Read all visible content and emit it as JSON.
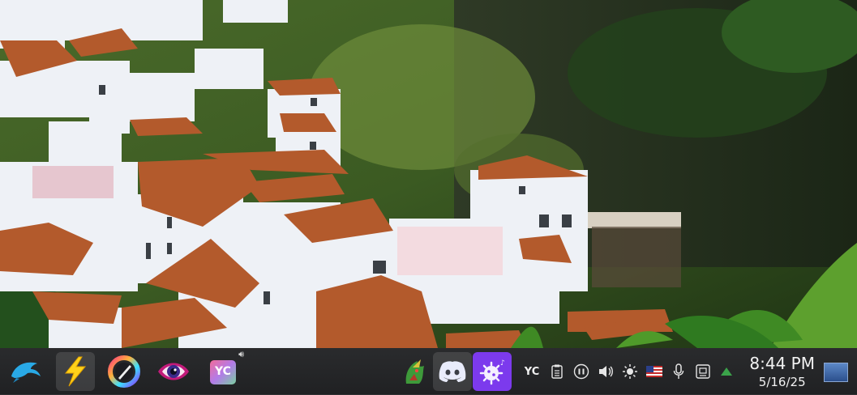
{
  "taskbar": {
    "launchers": [
      {
        "name": "Dolphin",
        "icon": "dolphin-icon"
      },
      {
        "name": "Lightning",
        "icon": "lightning-icon",
        "active": true
      },
      {
        "name": "Paint",
        "icon": "paint-brush-icon"
      },
      {
        "name": "Eye",
        "icon": "eye-icon"
      },
      {
        "name": "YC",
        "icon": "yc-app-icon",
        "label": "YC"
      }
    ],
    "tasks": [
      {
        "icon": "dragon-app-icon"
      },
      {
        "icon": "discord-icon",
        "active": true
      },
      {
        "icon": "virus-app-icon"
      }
    ],
    "tray": {
      "yc_label": "YC",
      "icons": [
        "yc-tray-icon",
        "clipboard-icon",
        "media-icon",
        "volume-icon",
        "brightness-icon",
        "us-flag-icon",
        "microphone-icon",
        "network-icon",
        "up-arrow-icon"
      ]
    },
    "clock": {
      "time": "8:44 PM",
      "date": "5/16/25"
    }
  },
  "colors": {
    "taskbar_bg": "#242527",
    "accent_green": "#3ba34a",
    "discord": "#5865f2",
    "virus_app": "#7c3aed"
  }
}
